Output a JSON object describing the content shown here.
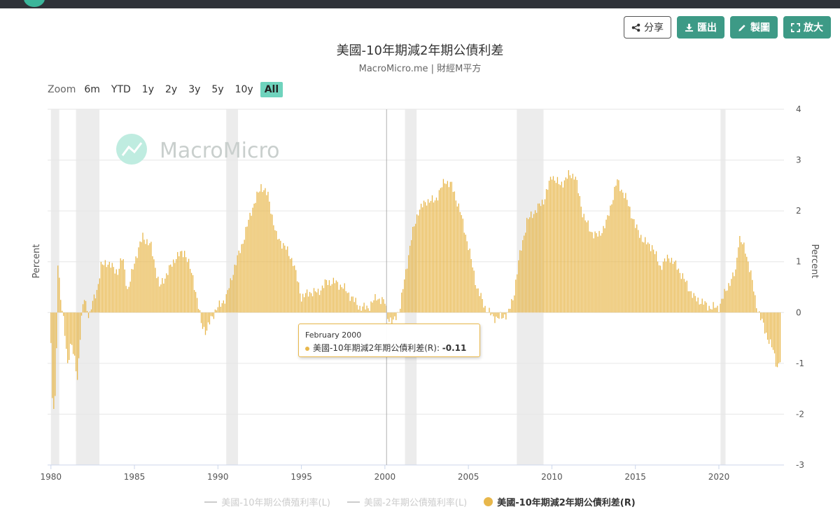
{
  "toolbar": {
    "share_label": "分享",
    "export_label": "匯出",
    "draw_label": "製圖",
    "expand_label": "放大"
  },
  "zoom": {
    "label": "Zoom",
    "options": [
      "6m",
      "YTD",
      "1y",
      "2y",
      "3y",
      "5y",
      "10y",
      "All"
    ],
    "active": "All"
  },
  "watermark": "MacroMicro",
  "colors": {
    "bar": "#e8b74b",
    "recession": "#ececec",
    "grid": "#e6e6e6",
    "accent": "#6fd3bd",
    "brand": "#3d9a86"
  },
  "tooltip": {
    "date": "February 2000",
    "series": "美國-10年期減2年期公債利差(R)",
    "value": "-0.11"
  },
  "chart_data": {
    "type": "bar",
    "title": "美國-10年期減2年期公債利差",
    "subtitle": "MacroMicro.me | 財經M平方",
    "xlabel": "",
    "ylabel_left": "Percent",
    "ylabel_right": "Percent",
    "xlim": [
      1979.8,
      2023.9
    ],
    "ylim": [
      -3,
      4
    ],
    "yticks": [
      4,
      3,
      2,
      1,
      0,
      -1,
      -2,
      -3
    ],
    "xticks": [
      1980,
      1985,
      1990,
      1995,
      2000,
      2005,
      2010,
      2015,
      2020
    ],
    "grid": true,
    "recessions": [
      [
        1980.0,
        1980.5
      ],
      [
        1981.5,
        1982.9
      ],
      [
        1990.5,
        1991.2
      ],
      [
        2001.2,
        2001.9
      ],
      [
        2007.9,
        2009.5
      ],
      [
        2020.1,
        2020.4
      ]
    ],
    "crosshair_x": 2000.1,
    "keypoints": [
      [
        1980.0,
        -0.6
      ],
      [
        1980.1,
        -2.0
      ],
      [
        1980.3,
        -1.6
      ],
      [
        1980.4,
        1.1
      ],
      [
        1980.6,
        0.2
      ],
      [
        1980.8,
        -0.3
      ],
      [
        1981.0,
        -1.0
      ],
      [
        1981.2,
        -0.6
      ],
      [
        1981.4,
        -0.9
      ],
      [
        1981.6,
        -1.3
      ],
      [
        1981.8,
        -0.2
      ],
      [
        1982.0,
        0.3
      ],
      [
        1982.3,
        -0.1
      ],
      [
        1982.5,
        0.2
      ],
      [
        1982.8,
        0.5
      ],
      [
        1983.0,
        0.9
      ],
      [
        1983.3,
        1.0
      ],
      [
        1984.0,
        0.8
      ],
      [
        1984.3,
        1.1
      ],
      [
        1984.6,
        0.4
      ],
      [
        1985.0,
        1.0
      ],
      [
        1985.5,
        1.5
      ],
      [
        1986.0,
        1.3
      ],
      [
        1986.5,
        0.5
      ],
      [
        1987.0,
        0.8
      ],
      [
        1987.5,
        1.1
      ],
      [
        1988.0,
        1.2
      ],
      [
        1988.5,
        0.7
      ],
      [
        1989.0,
        -0.2
      ],
      [
        1989.3,
        -0.4
      ],
      [
        1989.6,
        -0.1
      ],
      [
        1990.0,
        0.1
      ],
      [
        1990.5,
        0.3
      ],
      [
        1991.0,
        0.9
      ],
      [
        1991.5,
        1.4
      ],
      [
        1992.0,
        2.0
      ],
      [
        1992.6,
        2.5
      ],
      [
        1993.0,
        2.3
      ],
      [
        1993.5,
        1.5
      ],
      [
        1994.0,
        1.3
      ],
      [
        1994.5,
        1.0
      ],
      [
        1995.0,
        0.3
      ],
      [
        1995.5,
        0.4
      ],
      [
        1996.0,
        0.4
      ],
      [
        1996.5,
        0.6
      ],
      [
        1997.0,
        0.6
      ],
      [
        1997.5,
        0.5
      ],
      [
        1998.0,
        0.3
      ],
      [
        1998.5,
        0.1
      ],
      [
        1999.0,
        0.1
      ],
      [
        1999.5,
        0.3
      ],
      [
        2000.0,
        0.2
      ],
      [
        2000.2,
        -0.11
      ],
      [
        2000.5,
        -0.2
      ],
      [
        2000.9,
        0.1
      ],
      [
        2001.2,
        0.7
      ],
      [
        2001.6,
        1.5
      ],
      [
        2002.0,
        2.0
      ],
      [
        2002.5,
        2.2
      ],
      [
        2003.0,
        2.2
      ],
      [
        2003.6,
        2.6
      ],
      [
        2004.0,
        2.5
      ],
      [
        2004.5,
        2.0
      ],
      [
        2005.0,
        1.3
      ],
      [
        2005.5,
        0.5
      ],
      [
        2006.0,
        0.1
      ],
      [
        2006.5,
        -0.1
      ],
      [
        2007.0,
        -0.1
      ],
      [
        2007.4,
        0.0
      ],
      [
        2007.7,
        0.3
      ],
      [
        2008.0,
        1.0
      ],
      [
        2008.5,
        1.8
      ],
      [
        2009.0,
        2.0
      ],
      [
        2009.5,
        2.2
      ],
      [
        2010.0,
        2.7
      ],
      [
        2010.5,
        2.5
      ],
      [
        2011.0,
        2.7
      ],
      [
        2011.4,
        2.7
      ],
      [
        2011.8,
        2.0
      ],
      [
        2012.3,
        1.6
      ],
      [
        2012.8,
        1.5
      ],
      [
        2013.3,
        1.8
      ],
      [
        2013.9,
        2.6
      ],
      [
        2014.5,
        2.2
      ],
      [
        2015.0,
        1.7
      ],
      [
        2015.5,
        1.4
      ],
      [
        2016.0,
        1.3
      ],
      [
        2016.5,
        0.9
      ],
      [
        2017.0,
        1.1
      ],
      [
        2017.5,
        0.9
      ],
      [
        2018.0,
        0.6
      ],
      [
        2018.5,
        0.3
      ],
      [
        2019.0,
        0.2
      ],
      [
        2019.5,
        0.1
      ],
      [
        2020.0,
        0.1
      ],
      [
        2020.5,
        0.5
      ],
      [
        2021.0,
        0.8
      ],
      [
        2021.2,
        1.5
      ],
      [
        2021.6,
        1.2
      ],
      [
        2021.9,
        0.8
      ],
      [
        2022.2,
        0.2
      ],
      [
        2022.5,
        -0.1
      ],
      [
        2022.8,
        -0.4
      ],
      [
        2023.2,
        -0.7
      ],
      [
        2023.5,
        -1.07
      ],
      [
        2023.7,
        -0.9
      ]
    ]
  },
  "legend": [
    {
      "label": "美國-10年期公債殖利率(L)",
      "state": "off"
    },
    {
      "label": "美國-2年期公債殖利率(L)",
      "state": "off"
    },
    {
      "label": "美國-10年期減2年期公債利差(R)",
      "state": "on"
    }
  ]
}
